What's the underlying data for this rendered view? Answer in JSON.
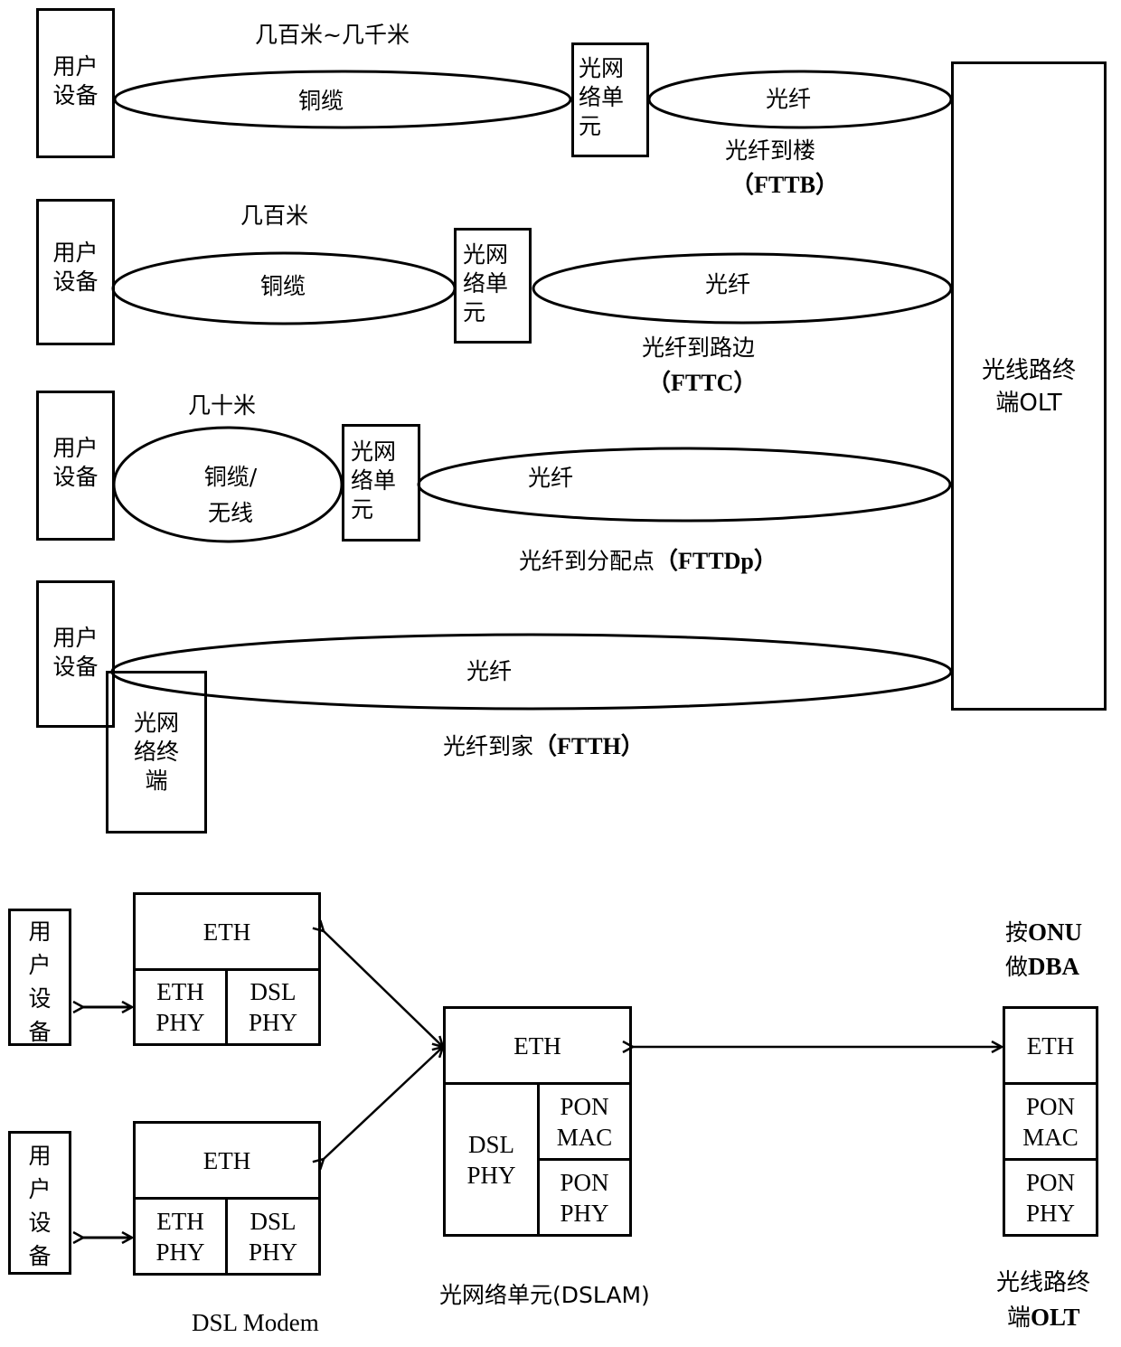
{
  "top_diagram": {
    "olt_label": "光线路终端OLT",
    "rows": [
      {
        "user_device": "用户设备",
        "distance": "几百米~几千米",
        "copper_label": "铜缆",
        "onu_label": "光网络单元",
        "fiber_label": "光纤",
        "scheme_cn": "光纤到楼",
        "scheme_en": "（FTTB）"
      },
      {
        "user_device": "用户设备",
        "distance": "几百米",
        "copper_label": "铜缆",
        "onu_label": "光网络单元",
        "fiber_label": "光纤",
        "scheme_cn": "光纤到路边",
        "scheme_en": "（FTTC）"
      },
      {
        "user_device": "用户设备",
        "distance": "几十米",
        "copper_label": "铜缆/无线",
        "onu_label": "光网络单元",
        "fiber_label": "光纤",
        "scheme_cn": "光纤到分配点",
        "scheme_en": "（FTTDp）"
      },
      {
        "user_device": "用户设备",
        "onu_label": "光网络终端",
        "fiber_label": "光纤",
        "scheme_cn": "光纤到家",
        "scheme_en": "（FTTH）"
      }
    ]
  },
  "bottom_diagram": {
    "modems": [
      {
        "user_device": "用户设备",
        "top": "ETH",
        "left": "ETH PHY",
        "right": "DSL PHY"
      },
      {
        "user_device": "用户设备",
        "top": "ETH",
        "left": "ETH PHY",
        "right": "DSL PHY"
      }
    ],
    "modem_caption": "DSL Modem",
    "dslam": {
      "top": "ETH",
      "left": "DSL PHY",
      "right_top": "PON MAC",
      "right_bottom": "PON PHY",
      "caption": "光网络单元(DSLAM)"
    },
    "olt": {
      "note_line1_cn": "按",
      "note_line1_en": "ONU",
      "note_line2_cn": "做",
      "note_line2_en": "DBA",
      "top": "ETH",
      "mid": "PON MAC",
      "bottom": "PON PHY",
      "caption_line1": "光线路终",
      "caption_line2_cn": "端",
      "caption_line2_en": "OLT"
    }
  }
}
